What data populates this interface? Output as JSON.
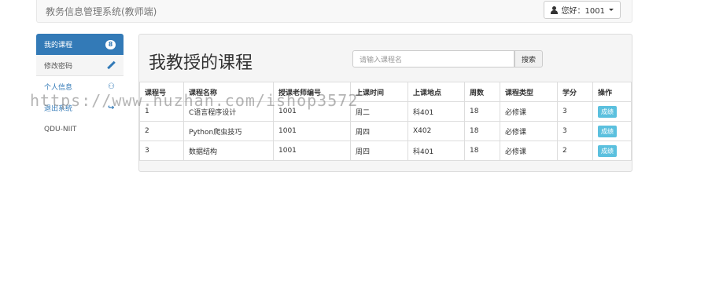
{
  "navbar": {
    "brand": "教务信息管理系统(教师端)",
    "user_label": "您好：1001"
  },
  "sidebar": {
    "items": [
      {
        "label": "我的课程",
        "badge": "8"
      },
      {
        "label": "修改密码"
      },
      {
        "label": "个人信息"
      },
      {
        "label": "退出系统"
      },
      {
        "label": "QDU-NIIT"
      }
    ]
  },
  "main": {
    "title": "我教授的课程",
    "search_placeholder": "请输入课程名",
    "search_button": "搜索",
    "table": {
      "headers": [
        "课程号",
        "课程名称",
        "授课老师编号",
        "上课时间",
        "上课地点",
        "周数",
        "课程类型",
        "学分",
        "操作"
      ],
      "rows": [
        [
          "1",
          "C语言程序设计",
          "1001",
          "周二",
          "科401",
          "18",
          "必修课",
          "3",
          "成绩"
        ],
        [
          "2",
          "Python爬虫技巧",
          "1001",
          "周四",
          "X402",
          "18",
          "必修课",
          "3",
          "成绩"
        ],
        [
          "3",
          "数据结构",
          "1001",
          "周四",
          "科401",
          "18",
          "必修课",
          "2",
          "成绩"
        ]
      ]
    }
  },
  "watermark": "https://www.huzhan.com/ishop3572",
  "colors": {
    "primary": "#337ab7",
    "info": "#5bc0de"
  }
}
